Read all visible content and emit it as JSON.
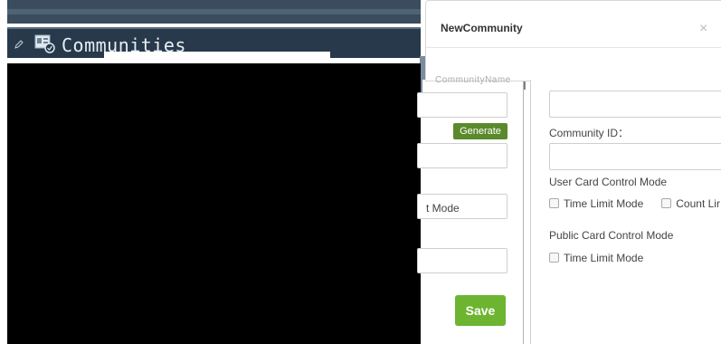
{
  "legacy_window": {
    "title": "Communities"
  },
  "background_form": {
    "generate_label": "Generate",
    "mode_label_partial": "t Mode",
    "save_label": "Save"
  },
  "dialog": {
    "title": "NewCommunity",
    "close_glyph": "×",
    "community_name_label": "CommunityName",
    "community_id_label": "Community ID：",
    "user_card_mode_label": "User Card Control Mode",
    "user_card_options": [
      "Time Limit Mode",
      "Count Lir"
    ],
    "public_card_mode_label": "Public Card Control Mode",
    "public_card_options": [
      "Time Limit Mode"
    ]
  },
  "colors": {
    "title_bar": "#27394b",
    "generate_button": "#5a8a2c",
    "save_button": "#6db531"
  },
  "icons": {
    "pencil": "pencil-icon",
    "communities": "community-window-icon",
    "close": "close-icon"
  }
}
